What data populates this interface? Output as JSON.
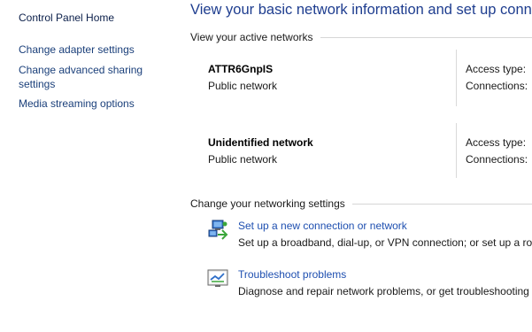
{
  "nav": {
    "home": "Control Panel Home",
    "items": [
      {
        "label": "Change adapter settings"
      },
      {
        "label": "Change advanced sharing settings"
      },
      {
        "label": "Media streaming options"
      }
    ]
  },
  "main": {
    "title": "View your basic network information and set up connections",
    "active_networks_heading": "View your active networks",
    "networks": [
      {
        "name": "ATTR6GnpIS",
        "type": "Public network",
        "access_label": "Access type:",
        "connections_label": "Connections:"
      },
      {
        "name": "Unidentified network",
        "type": "Public network",
        "access_label": "Access type:",
        "connections_label": "Connections:"
      }
    ],
    "settings_heading": "Change your networking settings",
    "tasks": [
      {
        "icon": "new-connection-icon",
        "link": "Set up a new connection or network",
        "description": "Set up a broadband, dial-up, or VPN connection; or set up a router or access point."
      },
      {
        "icon": "troubleshoot-icon",
        "link": "Troubleshoot problems",
        "description": "Diagnose and repair network problems, or get troubleshooting information."
      }
    ]
  },
  "colors": {
    "title": "#1e3d8f",
    "link": "#1e4fb0",
    "nav_link": "#1a3f7a",
    "divider": "#d6d6d6"
  }
}
